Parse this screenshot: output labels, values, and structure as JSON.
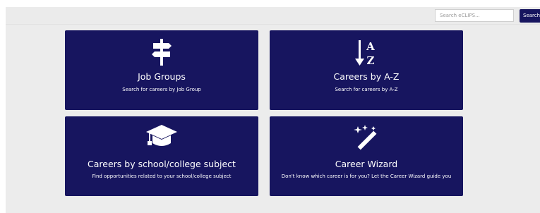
{
  "header": {
    "search_placeholder": "Search eCLIPS...",
    "search_button_label": "Search"
  },
  "tiles": [
    {
      "icon": "signpost-icon",
      "title": "Job Groups",
      "subtitle": "Search for careers by Job Group"
    },
    {
      "icon": "sort-a-z-icon",
      "title": "Careers by A-Z",
      "subtitle": "Search for careers by A-Z"
    },
    {
      "icon": "graduation-cap-icon",
      "title": "Careers by school/college subject",
      "subtitle": "Find opportunities related to your school/college subject"
    },
    {
      "icon": "magic-wand-icon",
      "title": "Career Wizard",
      "subtitle": "Don't know which career is for you? Let the Career Wizard guide you"
    }
  ],
  "colors": {
    "tile_bg": "#17155f",
    "page_bg": "#ececec",
    "text": "#ffffff"
  }
}
